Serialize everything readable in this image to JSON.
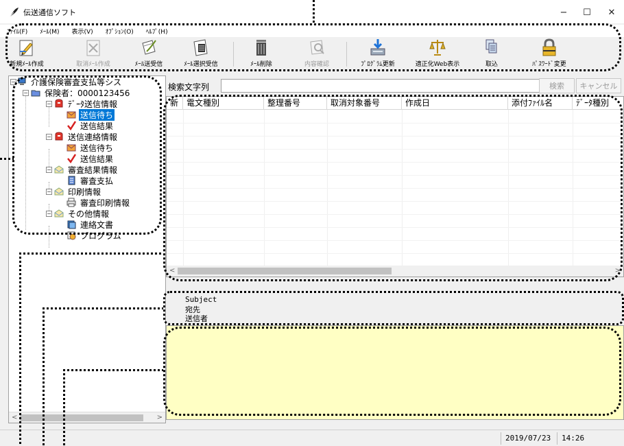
{
  "window": {
    "title": "伝送通信ソフト",
    "minimize": "−",
    "maximize": "☐",
    "close": "✕"
  },
  "menu": [
    "ﾌｧｲﾙ(F)",
    "ﾒｰﾙ(M)",
    "表示(V)",
    "ｵﾌﾟｼｮﾝ(O)",
    "ﾍﾙﾌﾟ(H)"
  ],
  "toolbar": [
    {
      "label": "新規ﾒｰﾙ作成",
      "icon": "new-mail-icon",
      "enabled": true
    },
    {
      "label": "取消ﾒｰﾙ作成",
      "icon": "cancel-mail-icon",
      "enabled": false
    },
    {
      "label": "ﾒｰﾙ送受信",
      "icon": "send-receive-icon",
      "enabled": true
    },
    {
      "label": "ﾒｰﾙ選択受信",
      "icon": "select-receive-icon",
      "enabled": true
    },
    {
      "label": "ﾒｰﾙ削除",
      "icon": "trash-icon",
      "enabled": true
    },
    {
      "label": "内容確認",
      "icon": "inspect-icon",
      "enabled": false
    },
    {
      "label": "ﾌﾟﾛｸﾞﾗﾑ更新",
      "icon": "program-update-icon",
      "enabled": true
    },
    {
      "label": "適正化Web表示",
      "icon": "scales-icon",
      "enabled": true
    },
    {
      "label": "取込",
      "icon": "import-icon",
      "enabled": true
    },
    {
      "label": "ﾊﾟｽﾜｰﾄﾞ変更",
      "icon": "lock-icon",
      "enabled": true
    }
  ],
  "tree": {
    "root": "介護保険審査支払等シス",
    "insurer": "保険者：0000123456",
    "groups": [
      {
        "label": "ﾃﾞｰﾀ送信情報",
        "children": [
          "送信待ち",
          "送信結果"
        ]
      },
      {
        "label": "送信連絡情報",
        "children": [
          "送信待ち",
          "送信結果"
        ]
      },
      {
        "label": "審査結果情報",
        "children": [
          "審査支払"
        ]
      },
      {
        "label": "印刷情報",
        "children": [
          "審査印刷情報"
        ]
      },
      {
        "label": "その他情報",
        "children": [
          "連絡文書",
          "プログラム"
        ]
      }
    ],
    "selected": "送信待ち"
  },
  "search": {
    "label": "検索文字列",
    "value": "",
    "search_button": "検索",
    "cancel_button": "キャンセル"
  },
  "list": {
    "columns": [
      "新",
      "電文種別",
      "整理番号",
      "取消対象番号",
      "作成日",
      "添付ﾌｧｲﾙ名",
      "ﾃﾞｰﾀ種別"
    ],
    "rows": []
  },
  "mail_header": {
    "subject_label": "Subject",
    "to_label": "宛先",
    "from_label": "送信者"
  },
  "status": {
    "date": "2019/07/23",
    "time": "14:26"
  }
}
